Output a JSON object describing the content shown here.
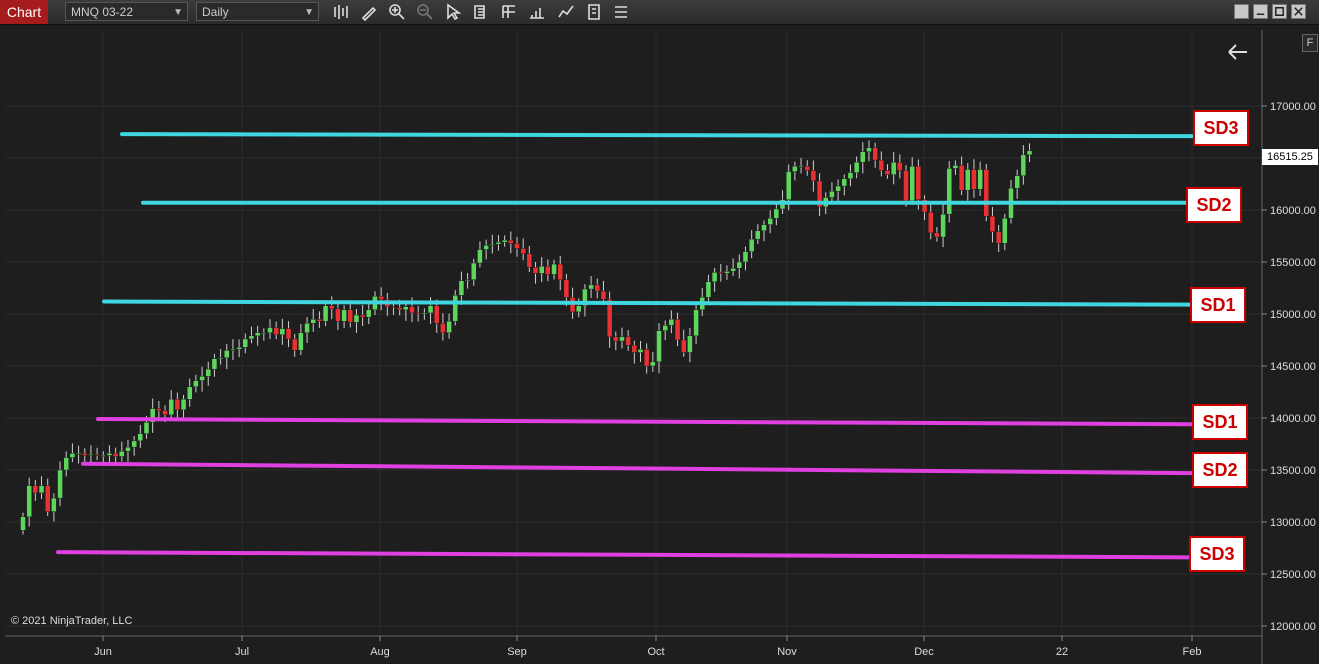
{
  "toolbar": {
    "tab_label": "Chart",
    "instrument": "MNQ 03-22",
    "interval": "Daily",
    "icons": [
      "bar-type-icon",
      "pencil-draw-icon",
      "zoom-in-icon",
      "zoom-out-icon",
      "pointer-icon",
      "data-box-icon",
      "properties-icon",
      "strategies-icon",
      "indicators-icon",
      "templates-icon",
      "chart-trader-icon"
    ],
    "window_buttons": [
      "minimize-icon",
      "restore-icon",
      "maximize-icon",
      "close-icon"
    ]
  },
  "chart_data": {
    "type": "candlestick",
    "instrument": "MNQ 03-22",
    "interval": "Daily",
    "ylim": [
      11900,
      17550
    ],
    "y_ticks": [
      "17000.00",
      "16500.00",
      "16000.00",
      "15500.00",
      "15000.00",
      "14500.00",
      "14000.00",
      "13500.00",
      "13000.00",
      "12500.00",
      "12000.00"
    ],
    "x_ticks": [
      "Jun",
      "Jul",
      "Aug",
      "Sep",
      "Oct",
      "Nov",
      "Dec",
      "22",
      "Feb"
    ],
    "last_price": "16515.25",
    "copyright": "© 2021 NinjaTrader, LLC",
    "levels": [
      {
        "label": "SD3",
        "kind": "upper",
        "color": "#3fd6e0",
        "start": 16730,
        "end": 16710
      },
      {
        "label": "SD2",
        "kind": "upper",
        "color": "#3fd6e0",
        "start": 16070,
        "end": 16070
      },
      {
        "label": "SD1",
        "kind": "upper",
        "color": "#3fd6e0",
        "start": 15120,
        "end": 15090
      },
      {
        "label": "SD1",
        "kind": "lower",
        "color": "#e040e0",
        "start": 13990,
        "end": 13940
      },
      {
        "label": "SD2",
        "kind": "lower",
        "color": "#e040e0",
        "start": 13560,
        "end": 13470
      },
      {
        "label": "SD3",
        "kind": "lower",
        "color": "#e040e0",
        "start": 12710,
        "end": 12660
      }
    ],
    "colors": {
      "up": "#5ed65e",
      "down": "#e63232",
      "wick": "#cfcfcf",
      "background": "#1e1e1e",
      "grid": "#2c2c2c"
    },
    "closes": [
      13050,
      13350,
      13280,
      13350,
      13100,
      13230,
      13500,
      13620,
      13660,
      13660,
      13640,
      13650,
      13640,
      13640,
      13660,
      13630,
      13680,
      13720,
      13780,
      13850,
      13960,
      14090,
      14070,
      14030,
      14180,
      14080,
      14180,
      14300,
      14360,
      14400,
      14470,
      14570,
      14580,
      14650,
      14660,
      14680,
      14760,
      14790,
      14820,
      14820,
      14870,
      14800,
      14860,
      14760,
      14650,
      14820,
      14910,
      14950,
      14930,
      15080,
      15050,
      14930,
      15040,
      14920,
      14990,
      14970,
      15040,
      15170,
      15140,
      15070,
      15060,
      15040,
      15070,
      15010,
      15000,
      15010,
      15080,
      14910,
      14820,
      14930,
      15180,
      15320,
      15330,
      15490,
      15620,
      15660,
      15670,
      15690,
      15710,
      15680,
      15630,
      15580,
      15450,
      15390,
      15460,
      15380,
      15480,
      15330,
      15160,
      15020,
      15080,
      15240,
      15280,
      15220,
      15140,
      14780,
      14740,
      14780,
      14700,
      14630,
      14660,
      14500,
      14540,
      14840,
      14890,
      14950,
      14750,
      14630,
      14790,
      15040,
      15160,
      15310,
      15400,
      15390,
      15410,
      15440,
      15500,
      15600,
      15720,
      15800,
      15860,
      15920,
      16010,
      16100,
      16370,
      16420,
      16420,
      16380,
      16280,
      16030,
      16120,
      16180,
      16230,
      16300,
      16360,
      16460,
      16560,
      16600,
      16480,
      16380,
      16340,
      16460,
      16380,
      16090,
      16420,
      16100,
      15980,
      15780,
      15740,
      15960,
      16400,
      16430,
      16190,
      16390,
      16200,
      16390,
      15940,
      15790,
      15680,
      15920,
      16210,
      16330,
      16530,
      16570
    ]
  },
  "overlay": {
    "back_arrow": "back-arrow-icon",
    "f_button": "F"
  }
}
